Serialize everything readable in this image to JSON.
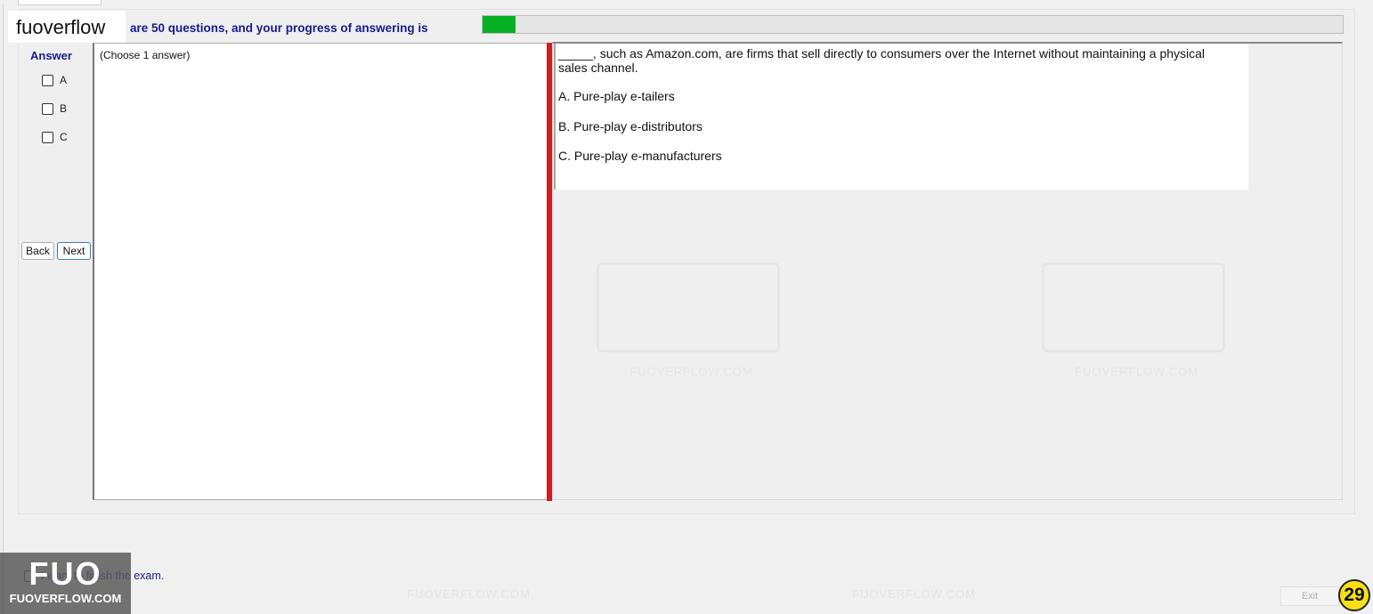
{
  "header": {
    "brand": "fuoverflow",
    "progress_text": "are 50 questions, and your progress of answering is",
    "progress_fraction": 0.038
  },
  "answer_panel": {
    "title": "Answer",
    "options": [
      "A",
      "B",
      "C"
    ],
    "hint": "(Choose 1 answer)"
  },
  "nav": {
    "back_label": "Back",
    "next_label": "Next"
  },
  "question": {
    "text": "_____, such as Amazon.com,  are firms that sell directly to consumers over the Internet without maintaining a physical sales channel.",
    "options": [
      "A.  Pure-play e-tailers",
      "B.  Pure-play e-distributors",
      "C.  Pure-play e-manufacturers"
    ]
  },
  "footer": {
    "finish_label": "I want to finish the exam.",
    "exit_label": "Exit",
    "question_number": "29"
  },
  "watermark": {
    "logo_big": "FUO",
    "logo_small": "FUOVERFLOW.COM",
    "tile_text": "FUOVERFLOW.COM"
  },
  "colors": {
    "accent_text": "#1a1a8c",
    "progress_fill": "#06b025",
    "divider": "#cc1f1f",
    "badge": "#f7e116"
  }
}
